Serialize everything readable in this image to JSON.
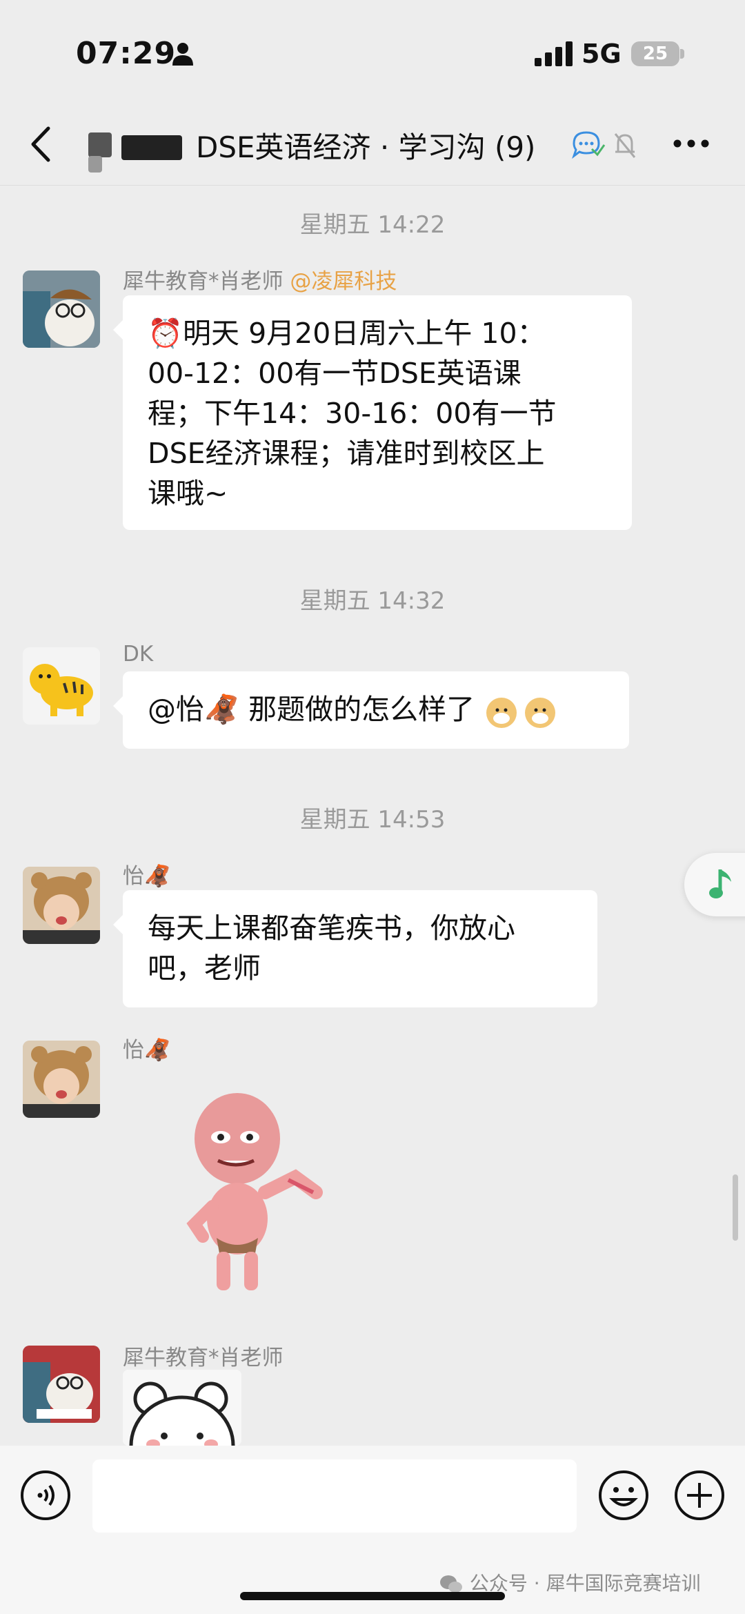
{
  "status_bar": {
    "time": "07:29",
    "network": "5G",
    "battery": "25"
  },
  "nav": {
    "title": "DSE英语经济 · 学习沟 (9)"
  },
  "messages": [
    {
      "time": "星期五 14:22",
      "sender": "犀牛教育*肖老师",
      "mention": "@凌犀科技",
      "line1": "⏰明天 9月20日周六上午 10：",
      "line2": "00-12：00有一节DSE英语课",
      "line3": "程；下午14：30-16：00有一节",
      "line4": "DSE经济课程；请准时到校区上",
      "line5": "课哦~"
    },
    {
      "time": "星期五 14:32",
      "sender": "DK",
      "text": "@怡🦧 那题做的怎么样了"
    },
    {
      "time": "星期五 14:53",
      "sender": "怡🦧",
      "line1": "每天上课都奋笔疾书，你放心",
      "line2": "吧，老师"
    },
    {
      "sender": "怡🦧"
    },
    {
      "sender": "犀牛教育*肖老师"
    }
  ],
  "footer": {
    "watermark": "公众号 · 犀牛国际竞赛培训"
  },
  "colors": {
    "background": "#ededed",
    "bubble": "#ffffff",
    "mention": "#e8a245",
    "music": "#3cb371"
  }
}
